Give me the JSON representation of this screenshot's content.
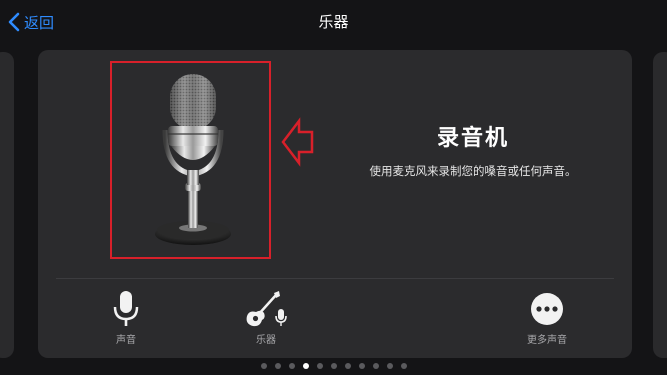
{
  "nav": {
    "back_label": "返回",
    "title": "乐器"
  },
  "instrument": {
    "name": "录音机",
    "description": "使用麦克风来录制您的嗓音或任何声音。",
    "highlight_color": "#d8202a"
  },
  "tabs": [
    {
      "label": "声音",
      "icon": "microphone-icon"
    },
    {
      "label": "乐器",
      "icon": "guitar-mic-icon"
    },
    {
      "label": "更多声音",
      "icon": "more-icon"
    }
  ],
  "pager": {
    "page_count": 11,
    "current_page": 4
  },
  "colors": {
    "accent": "#2f8cff",
    "background": "#141416",
    "card": "#2b2b2d"
  }
}
